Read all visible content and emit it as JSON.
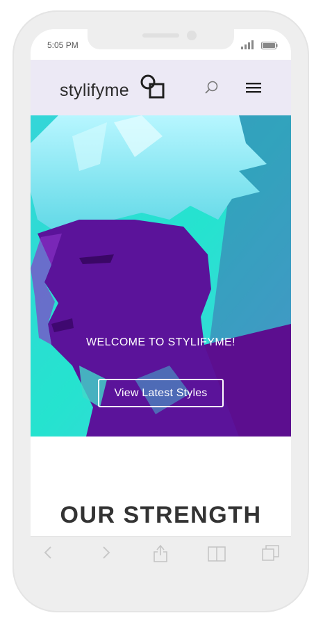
{
  "status_bar": {
    "time": "5:05 PM"
  },
  "header": {
    "logo_text": "stylifyme",
    "icons": {
      "search": "search-icon",
      "menu": "hamburger-menu-icon"
    }
  },
  "hero": {
    "title": "WELCOME TO STYLIFYME!",
    "button_label": "View Latest Styles",
    "colors": {
      "cyan": "#2de0d4",
      "purple": "#5a0f8c"
    }
  },
  "section": {
    "title": "OUR STRENGTH"
  },
  "toolbar": {
    "icons": [
      "back-icon",
      "forward-icon",
      "share-icon",
      "bookmarks-icon",
      "tabs-icon"
    ]
  },
  "colors": {
    "header_bg": "#ece9f5",
    "frame": "#eeeeee",
    "text_dark": "#333333"
  }
}
